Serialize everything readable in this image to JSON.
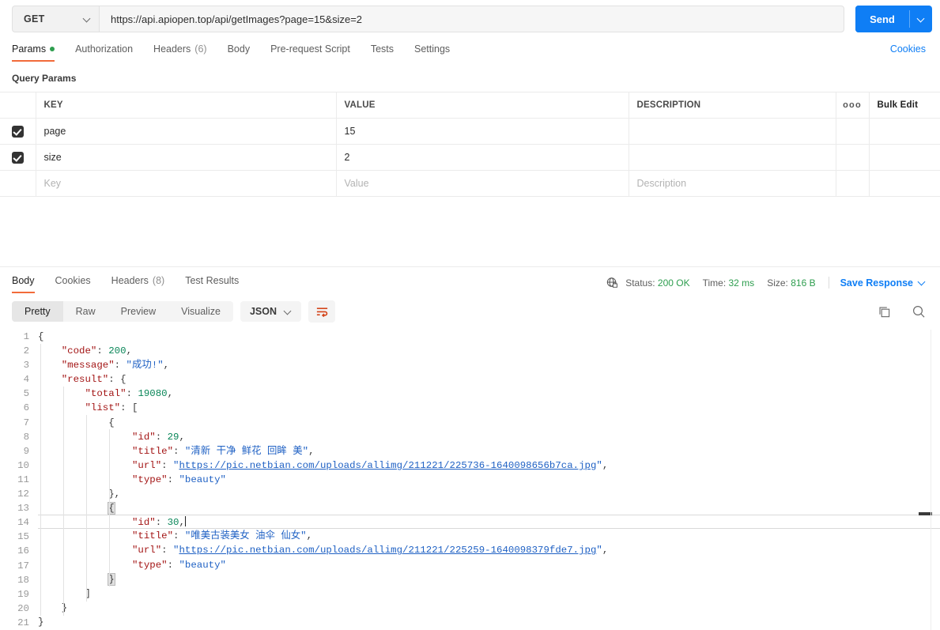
{
  "request": {
    "method": "GET",
    "url": "https://api.apiopen.top/api/getImages?page=15&size=2",
    "send_label": "Send"
  },
  "request_tabs": [
    {
      "label": "Params",
      "has_dot": true,
      "active": true
    },
    {
      "label": "Authorization",
      "active": false
    },
    {
      "label": "Headers",
      "count": "(6)",
      "active": false
    },
    {
      "label": "Body",
      "active": false
    },
    {
      "label": "Pre-request Script",
      "active": false
    },
    {
      "label": "Tests",
      "active": false
    },
    {
      "label": "Settings",
      "active": false
    }
  ],
  "cookies_link": "Cookies",
  "query_params": {
    "section_title": "Query Params",
    "headers": {
      "key": "KEY",
      "value": "VALUE",
      "description": "DESCRIPTION",
      "dots": "ooo",
      "bulk_edit": "Bulk Edit"
    },
    "rows": [
      {
        "checked": true,
        "key": "page",
        "value": "15",
        "description": ""
      },
      {
        "checked": true,
        "key": "size",
        "value": "2",
        "description": ""
      }
    ],
    "placeholder_row": {
      "key": "Key",
      "value": "Value",
      "description": "Description"
    }
  },
  "response": {
    "tabs": [
      {
        "label": "Body",
        "active": true
      },
      {
        "label": "Cookies",
        "active": false
      },
      {
        "label": "Headers",
        "count": "(8)",
        "active": false
      },
      {
        "label": "Test Results",
        "active": false
      }
    ],
    "status_label": "Status:",
    "status_value": "200 OK",
    "time_label": "Time:",
    "time_value": "32 ms",
    "size_label": "Size:",
    "size_value": "816 B",
    "save_response": "Save Response",
    "view_modes": [
      {
        "label": "Pretty",
        "active": true
      },
      {
        "label": "Raw",
        "active": false
      },
      {
        "label": "Preview",
        "active": false
      },
      {
        "label": "Visualize",
        "active": false
      }
    ],
    "format": "JSON"
  },
  "code": {
    "line_numbers": [
      "1",
      "2",
      "3",
      "4",
      "5",
      "6",
      "7",
      "8",
      "9",
      "10",
      "11",
      "12",
      "13",
      "14",
      "15",
      "16",
      "17",
      "18",
      "19",
      "20",
      "21"
    ],
    "lines": [
      "{",
      "    \"code\": 200,",
      "    \"message\": \"成功!\",",
      "    \"result\": {",
      "        \"total\": 19080,",
      "        \"list\": [",
      "            {",
      "                \"id\": 29,",
      "                \"title\": \"清新 干净 鲜花 回眸 美\",",
      "                \"url\": \"https://pic.netbian.com/uploads/allimg/211221/225736-1640098656b7ca.jpg\",",
      "                \"type\": \"beauty\"",
      "            },",
      "            {",
      "                \"id\": 30,",
      "                \"title\": \"唯美古装美女 油伞 仙女\",",
      "                \"url\": \"https://pic.netbian.com/uploads/allimg/211221/225259-1640098379fde7.jpg\",",
      "                \"type\": \"beauty\"",
      "            }",
      "        ]",
      "    }",
      "}"
    ],
    "json_value": {
      "code": 200,
      "message": "成功!",
      "result": {
        "total": 19080,
        "list": [
          {
            "id": 29,
            "title": "清新 干净 鲜花 回眸 美",
            "url": "https://pic.netbian.com/uploads/allimg/211221/225736-1640098656b7ca.jpg",
            "type": "beauty"
          },
          {
            "id": 30,
            "title": "唯美古装美女 油伞 仙女",
            "url": "https://pic.netbian.com/uploads/allimg/211221/225259-1640098379fde7.jpg",
            "type": "beauty"
          }
        ]
      }
    },
    "active_line": 14
  },
  "icons": {
    "method_chevron": "chevron-down-icon",
    "send_chevron": "chevron-down-icon",
    "globe_lock": "globe-lock-icon",
    "copy": "copy-icon",
    "search": "search-icon",
    "wrap": "wrap-lines-icon"
  },
  "colors": {
    "accent_orange": "#f26b3a",
    "blue": "#0f7ef5",
    "green": "#2e9e4f"
  }
}
